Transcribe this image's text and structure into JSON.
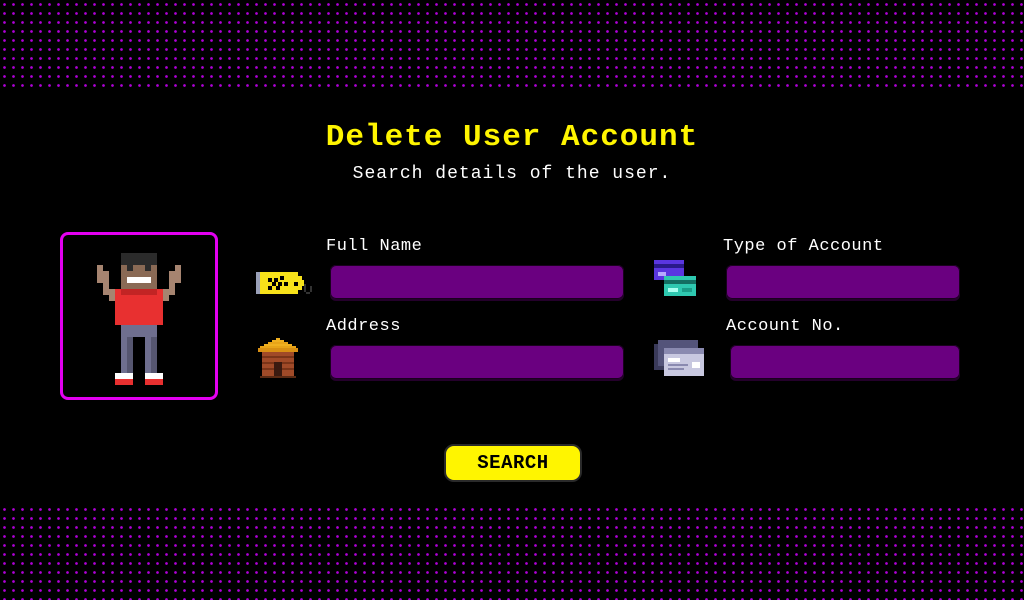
{
  "header": {
    "title": "Delete User Account",
    "subtitle": "Search details of the user."
  },
  "avatar": {
    "icon": "pixel-person-avatar-icon"
  },
  "form": {
    "full_name": {
      "label": "Full Name",
      "value": "",
      "icon": "name-tag-icon"
    },
    "type_of_account": {
      "label": "Type of Account",
      "value": "",
      "icon": "credit-cards-icon"
    },
    "address": {
      "label": "Address",
      "value": "",
      "icon": "hut-house-icon"
    },
    "account_no": {
      "label": "Account No.",
      "value": "",
      "icon": "bank-card-icon"
    }
  },
  "actions": {
    "search_label": "SEARCH"
  },
  "colors": {
    "background": "#000000",
    "accent_yellow": "#fff500",
    "field_purple": "#6a0080",
    "border_magenta": "#e300f0",
    "dots": "#b000d8"
  }
}
